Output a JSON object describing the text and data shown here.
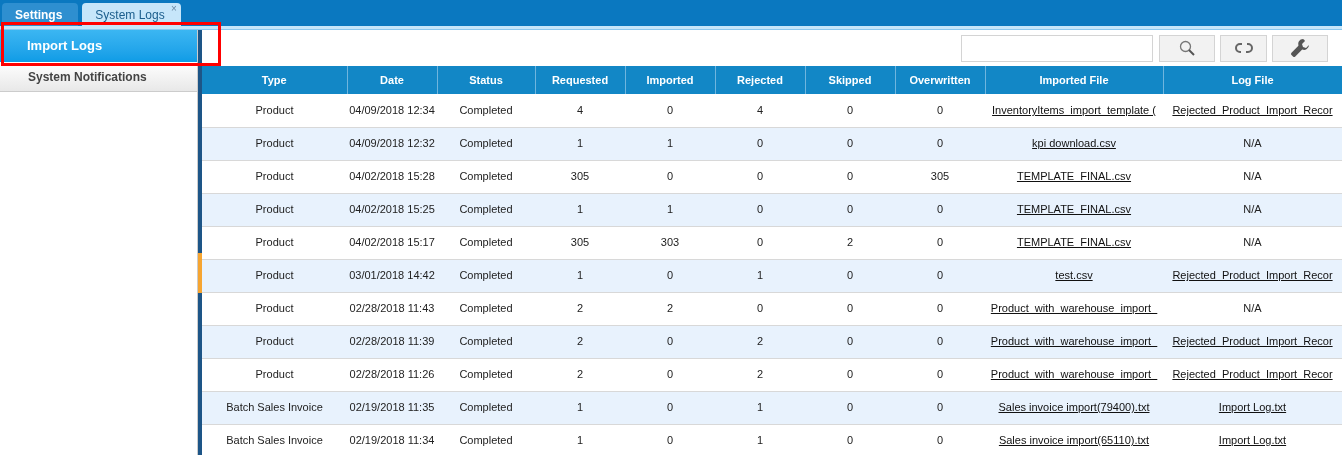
{
  "tabs": [
    {
      "label": "Settings",
      "selected": false
    },
    {
      "label": "System Logs",
      "selected": true,
      "close": "×"
    }
  ],
  "sidebar": {
    "items": [
      {
        "label": "Import Logs",
        "selected": true
      },
      {
        "label": "System Notifications",
        "selected": false
      }
    ]
  },
  "table": {
    "columns": [
      "Type",
      "Date",
      "Status",
      "Requested",
      "Imported",
      "Rejected",
      "Skipped",
      "Overwritten",
      "Imported File",
      "Log File"
    ],
    "rows": [
      [
        "Product",
        "04/09/2018 12:34",
        "Completed",
        "4",
        "0",
        "4",
        "0",
        "0",
        "InventoryItems_import_template (",
        "Rejected_Product_Import_Recor"
      ],
      [
        "Product",
        "04/09/2018 12:32",
        "Completed",
        "1",
        "1",
        "0",
        "0",
        "0",
        "kpi download.csv",
        "N/A"
      ],
      [
        "Product",
        "04/02/2018 15:28",
        "Completed",
        "305",
        "0",
        "0",
        "0",
        "305",
        "TEMPLATE_FINAL.csv",
        "N/A"
      ],
      [
        "Product",
        "04/02/2018 15:25",
        "Completed",
        "1",
        "1",
        "0",
        "0",
        "0",
        "TEMPLATE_FINAL.csv",
        "N/A"
      ],
      [
        "Product",
        "04/02/2018 15:17",
        "Completed",
        "305",
        "303",
        "0",
        "2",
        "0",
        "TEMPLATE_FINAL.csv",
        "N/A"
      ],
      [
        "Product",
        "03/01/2018 14:42",
        "Completed",
        "1",
        "0",
        "1",
        "0",
        "0",
        "test.csv",
        "Rejected_Product_Import_Recor"
      ],
      [
        "Product",
        "02/28/2018 11:43",
        "Completed",
        "2",
        "2",
        "0",
        "0",
        "0",
        "Product_with_warehouse_import_",
        "N/A"
      ],
      [
        "Product",
        "02/28/2018 11:39",
        "Completed",
        "2",
        "0",
        "2",
        "0",
        "0",
        "Product_with_warehouse_import_",
        "Rejected_Product_Import_Recor"
      ],
      [
        "Product",
        "02/28/2018 11:26",
        "Completed",
        "2",
        "0",
        "2",
        "0",
        "0",
        "Product_with_warehouse_import_",
        "Rejected_Product_Import_Recor"
      ],
      [
        "Batch Sales Invoice",
        "02/19/2018 11:35",
        "Completed",
        "1",
        "0",
        "1",
        "0",
        "0",
        "Sales invoice import(79400).txt",
        "Import Log.txt"
      ],
      [
        "Batch Sales Invoice",
        "02/19/2018 11:34",
        "Completed",
        "1",
        "0",
        "1",
        "0",
        "0",
        "Sales invoice import(65110).txt",
        "Import Log.txt"
      ]
    ]
  }
}
